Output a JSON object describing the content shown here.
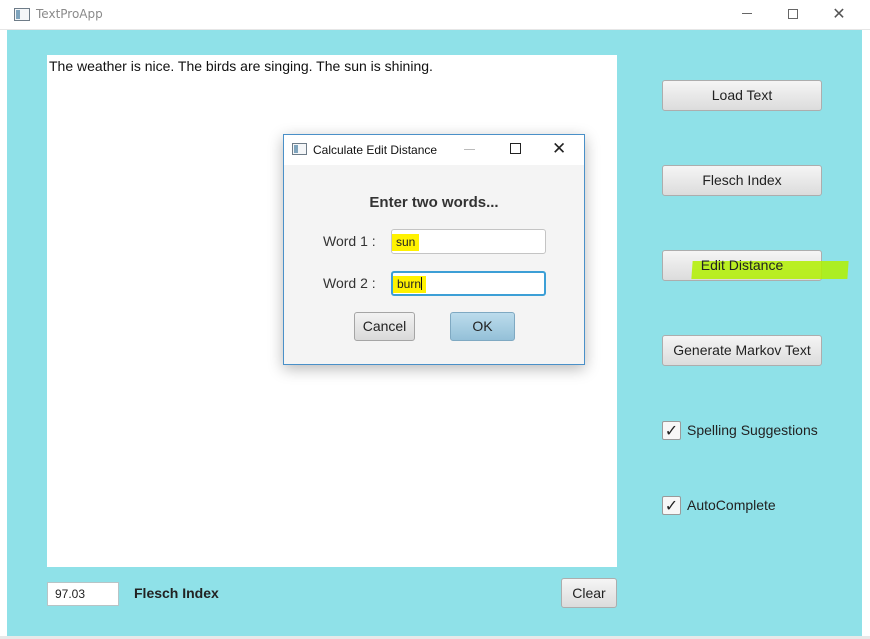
{
  "window": {
    "title": "TextProApp",
    "minimize_icon": "minimize-icon",
    "maximize_icon": "maximize-icon",
    "close_glyph": "✕"
  },
  "editor": {
    "text": "The weather is nice. The birds are singing. The sun is shining."
  },
  "sidebar": {
    "load_text": "Load Text",
    "flesch_index": "Flesch Index",
    "edit_distance": "Edit Distance",
    "generate_markov": "Generate Markov Text",
    "spelling_suggestions": {
      "label": "Spelling Suggestions",
      "checked": true
    },
    "autocomplete": {
      "label": "AutoComplete",
      "checked": true
    },
    "check_glyph": "✓"
  },
  "footer": {
    "score_value": "97.03",
    "score_label": "Flesch Index",
    "clear": "Clear"
  },
  "dialog": {
    "title": "Calculate Edit Distance",
    "close_glyph": "✕",
    "header": "Enter two words...",
    "word1_label": "Word 1 :",
    "word1_value": "sun",
    "word2_label": "Word 2 :",
    "word2_value": "burn",
    "cancel": "Cancel",
    "ok": "OK"
  },
  "colors": {
    "client_background": "#8fe1e8",
    "highlight_yellow": "#fff200",
    "highlight_green": "#b2f000",
    "focus_border": "#3c9fd6"
  }
}
